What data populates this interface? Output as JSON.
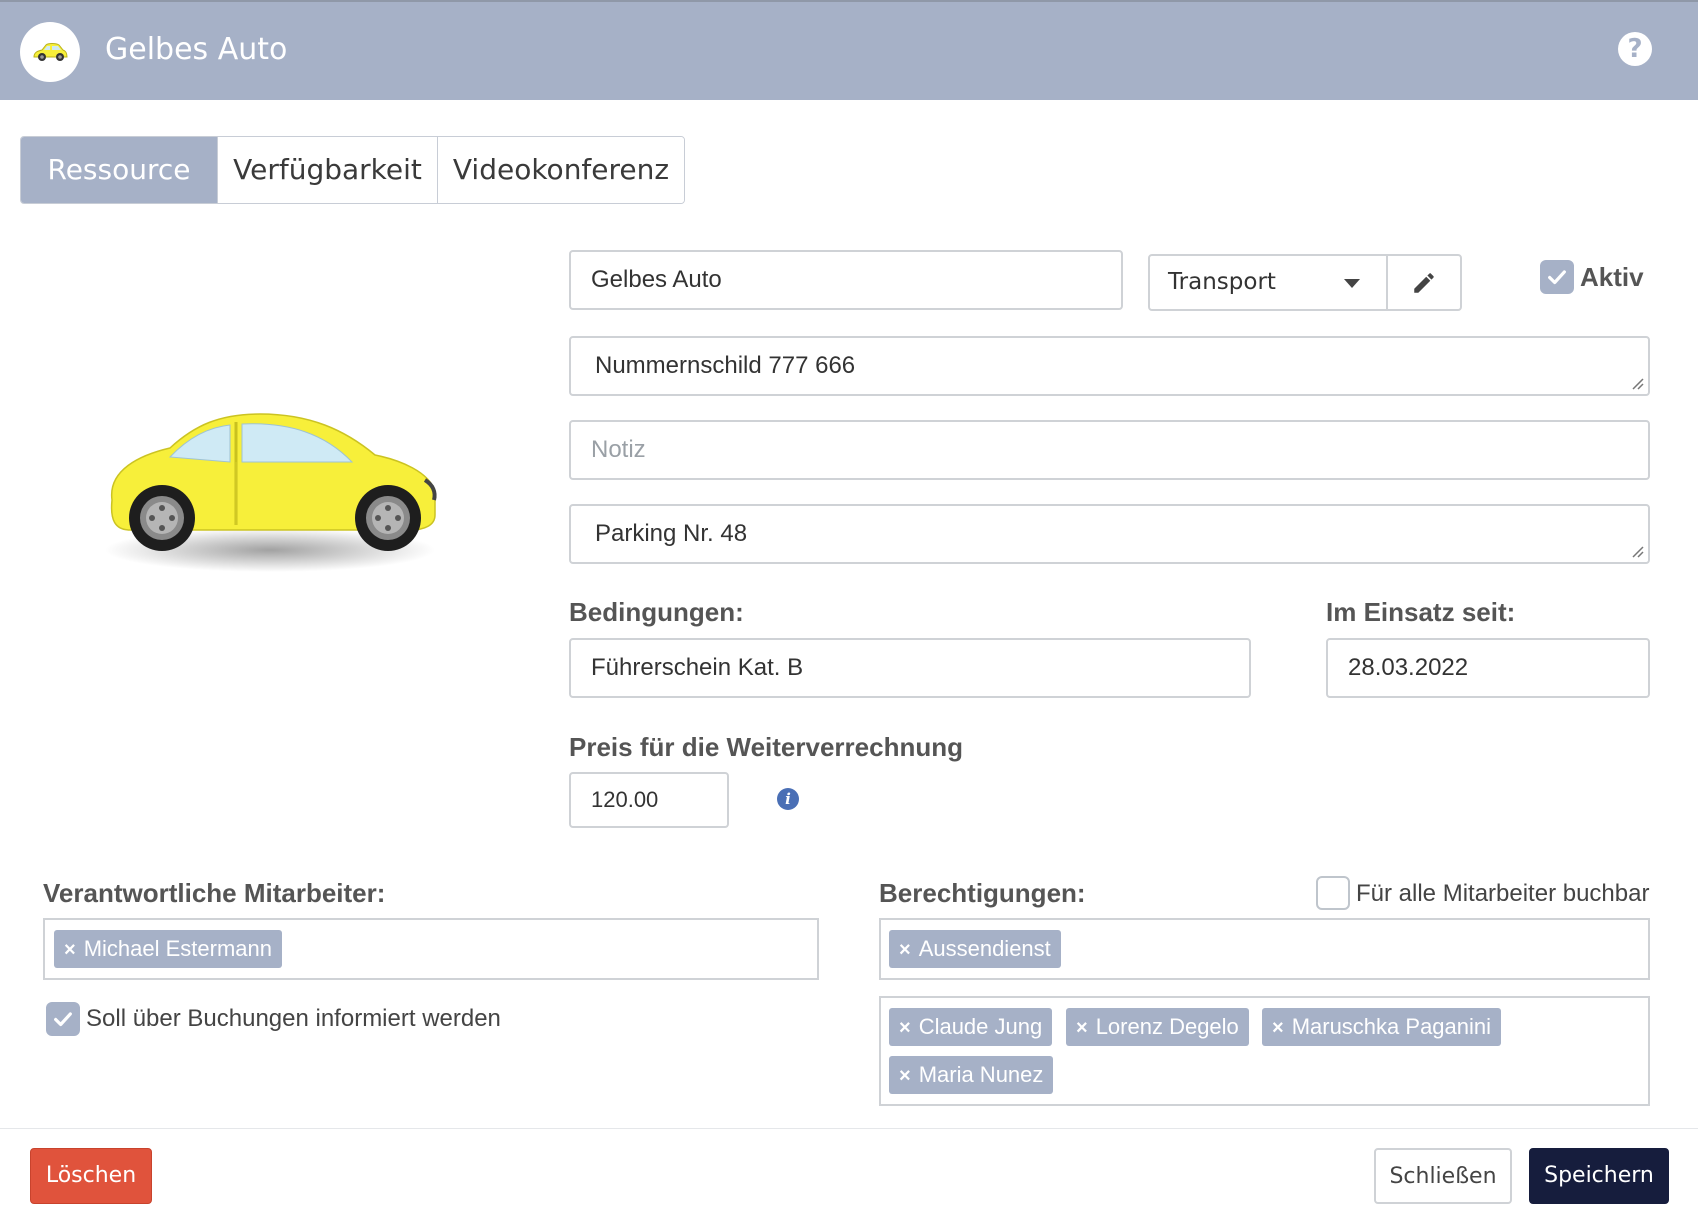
{
  "header": {
    "title": "Gelbes Auto",
    "help_icon": "question-circle-icon"
  },
  "tabs": [
    {
      "label": "Ressource",
      "active": true
    },
    {
      "label": "Verfügbarkeit",
      "active": false
    },
    {
      "label": "Videokonferenz",
      "active": false
    }
  ],
  "resource": {
    "name": "Gelbes Auto",
    "category": "Transport",
    "active_label": "Aktiv",
    "active_checked": true,
    "description": "Nummernschild 777 666",
    "note_placeholder": "Notiz",
    "location": "Parking Nr. 48",
    "conditions_label": "Bedingungen:",
    "conditions_value": "Führerschein Kat. B",
    "in_use_label": "Im Einsatz seit:",
    "in_use_value": "28.03.2022",
    "price_label": "Preis für die Weiterverrechnung",
    "price_value": "120.00"
  },
  "responsible": {
    "label": "Verantwortliche Mitarbeiter:",
    "tags": [
      "Michael Estermann"
    ],
    "notify_label": "Soll über Buchungen informiert werden",
    "notify_checked": true
  },
  "permissions": {
    "label": "Berechtigungen:",
    "all_bookable_label": "Für alle Mitarbeiter buchbar",
    "all_bookable_checked": false,
    "groups": [
      "Aussendienst"
    ],
    "people": [
      "Claude Jung",
      "Lorenz Degelo",
      "Maruschka Paganini",
      "Maria Nunez"
    ]
  },
  "footer": {
    "delete_label": "Löschen",
    "close_label": "Schließen",
    "save_label": "Speichern"
  },
  "colors": {
    "header": "#a6b1c7",
    "tag": "#a6b1c7",
    "delete": "#e0533c",
    "save": "#161d3d",
    "car": "#f7ef3a"
  }
}
